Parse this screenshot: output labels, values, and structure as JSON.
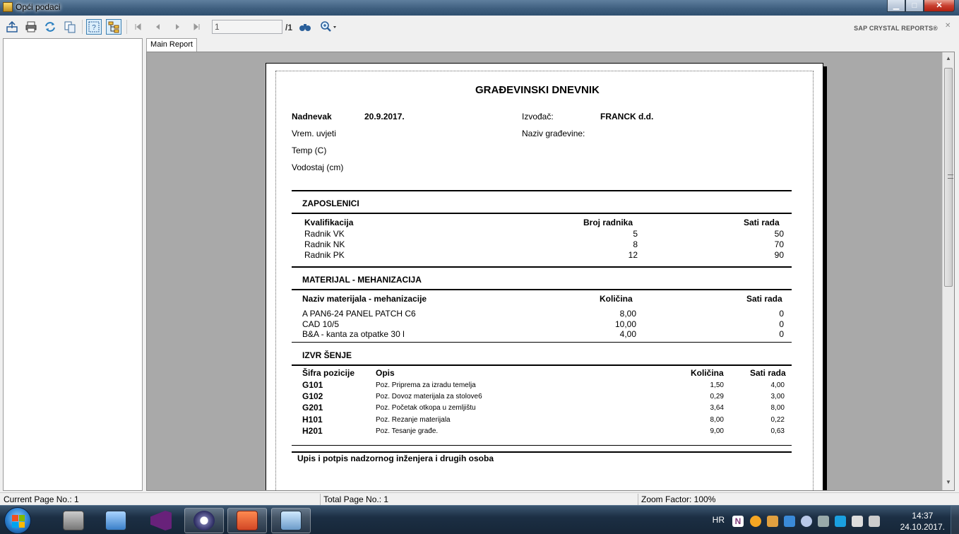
{
  "window": {
    "title": "Opći podaci"
  },
  "toolbar": {
    "page_value": "1",
    "page_total": "/1",
    "brand": "SAP CRYSTAL REPORTS®"
  },
  "tabs": [
    {
      "label": "Main Report"
    }
  ],
  "report": {
    "title": "GRAĐEVINSKI DNEVNIK",
    "header": {
      "date_label": "Nadnevak",
      "date_value": "20.9.2017.",
      "weather_label": "Vrem. uvjeti",
      "temp_label": "Temp (C)",
      "water_label": "Vodostaj (cm)",
      "contractor_label": "Izvođač:",
      "contractor_value": "FRANCK d.d.",
      "site_label": "Naziv građevine:"
    },
    "employees": {
      "section_title": "ZAPOSLENICI",
      "columns": [
        "Kvalifikacija",
        "Broj radnika",
        "Sati rada"
      ],
      "rows": [
        [
          "Radnik VK",
          "5",
          "50"
        ],
        [
          "Radnik NK",
          "8",
          "70"
        ],
        [
          "Radnik PK",
          "12",
          "90"
        ]
      ]
    },
    "materials": {
      "section_title": "MATERIJAL - MEHANIZACIJA",
      "columns": [
        "Naziv materijala - mehanizacije",
        "Količina",
        "Sati rada"
      ],
      "rows": [
        [
          "A PAN6-24 PANEL PATCH C6",
          "8,00",
          "0"
        ],
        [
          "CAD 10/5",
          "10,00",
          "0"
        ],
        [
          "B&A - kanta za otpatke 30 l",
          "4,00",
          "0"
        ]
      ]
    },
    "execution": {
      "section_title": "IZVR ŠENJE",
      "columns": [
        "Šifra pozicije",
        "Opis",
        "Količina",
        "Sati rada"
      ],
      "rows": [
        [
          "G101",
          "Poz. Priprema za izradu temelja",
          "1,50",
          "4,00"
        ],
        [
          "G102",
          "Poz. Dovoz materijala za stolove6",
          "0,29",
          "3,00"
        ],
        [
          "G201",
          "Poz. Početak otkopa u zemljištu",
          "3,64",
          "8,00"
        ],
        [
          "H101",
          "Poz. Rezanje materijala",
          "8,00",
          "0,22"
        ],
        [
          "H201",
          "Poz. Tesanje građe.",
          "9,00",
          "0,63"
        ]
      ]
    },
    "signature": "Upis i potpis nadzornog inženjera i drugih osoba"
  },
  "statusbar": {
    "current_page": "Current Page No.: 1",
    "total_page": "Total Page No.: 1",
    "zoom": "Zoom Factor: 100%"
  },
  "taskbar": {
    "language": "HR",
    "time": "14:37",
    "date": "24.10.2017."
  }
}
